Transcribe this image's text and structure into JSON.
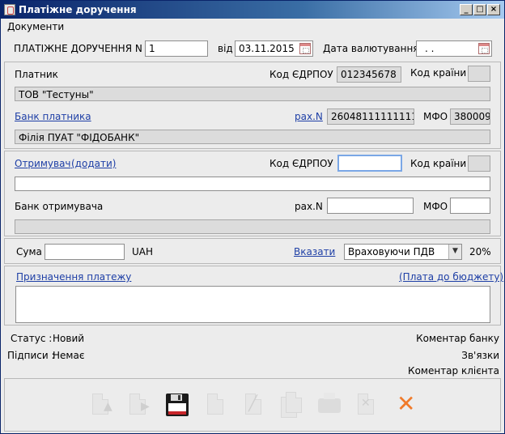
{
  "window": {
    "title": "Платіжне доручення",
    "buttons": [
      "_",
      "□",
      "×"
    ]
  },
  "menu": {
    "documents": "Документи"
  },
  "header": {
    "doc_label": "ПЛАТІЖНЕ ДОРУЧЕННЯ N",
    "doc_number": "1",
    "from_label": "від",
    "date": "03.11.2015",
    "value_date_label": "Дата валютування",
    "value_date": " .  ."
  },
  "payer": {
    "label": "Платник",
    "edrpou_label": "Код ЄДРПОУ",
    "edrpou": "012345678",
    "country_label": "Код країни",
    "country": "",
    "name": "ТОВ \"Тестуны\"",
    "bank_link": "Банк платника",
    "account_link": "рах.N",
    "account": "26048111111111",
    "mfo_label": "МФО",
    "mfo": "380009",
    "bank_name": "Філія ПУАТ \"ФІДОБАНК\""
  },
  "recipient": {
    "label_link": "Отримувач",
    "add_link": "(додати)",
    "edrpou_label": "Код ЄДРПОУ",
    "edrpou": "",
    "country_label": "Код країни",
    "country": "",
    "name": "",
    "bank_label": "Банк отримувача",
    "account_label": "рах.N",
    "account": "",
    "mfo_label": "МФО",
    "mfo": "",
    "bank_name": ""
  },
  "amount": {
    "label": "Сума",
    "value": "",
    "currency": "UAH",
    "specify_link": "Вказати",
    "vat_option": "Враховуючи ПДВ",
    "vat_rate": "20%"
  },
  "purpose": {
    "link": "Призначення платежу",
    "budget_link": "(Плата до бюджету)",
    "text": ""
  },
  "status": {
    "status_label": "Статус :",
    "status_value": "Новий",
    "signatures_label": "Підписи :",
    "signatures_value": "Немає",
    "bank_comment": "Коментар банку",
    "links": "Зв'язки",
    "client_comment": "Коментар клієнта"
  },
  "toolbar": {
    "icons": [
      "document-up-icon",
      "document-right-icon",
      "save-icon",
      "document-icon",
      "document-edit-icon",
      "document-copy-icon",
      "print-icon",
      "document-delete-icon",
      "close-icon"
    ],
    "accent_close": "#f07a2a",
    "accent_save": "#c8252a"
  }
}
